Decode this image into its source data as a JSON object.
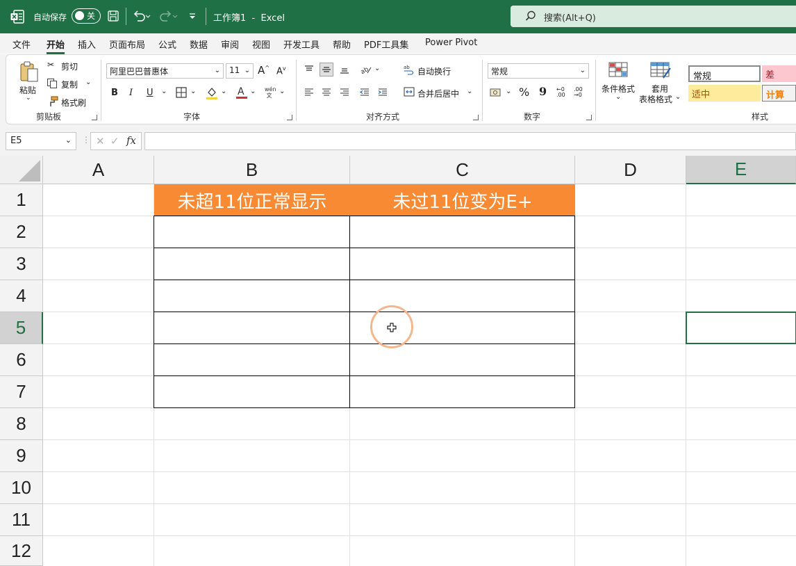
{
  "titlebar": {
    "autosave_label": "自动保存",
    "autosave_state": "关",
    "doc_title": "工作簿1  -  Excel",
    "search_placeholder": "搜索(Alt+Q)",
    "bg_color": "#1f7145"
  },
  "tabs": [
    {
      "label": "文件"
    },
    {
      "label": "开始",
      "active": true
    },
    {
      "label": "插入"
    },
    {
      "label": "页面布局"
    },
    {
      "label": "公式"
    },
    {
      "label": "数据"
    },
    {
      "label": "审阅"
    },
    {
      "label": "视图"
    },
    {
      "label": "开发工具"
    },
    {
      "label": "帮助"
    },
    {
      "label": "PDF工具集"
    },
    {
      "label": "Power Pivot"
    }
  ],
  "ribbon": {
    "clipboard": {
      "paste": "粘贴",
      "cut": "剪切",
      "copy": "复制",
      "format_painter": "格式刷",
      "group": "剪贴板"
    },
    "font": {
      "name": "阿里巴巴普惠体",
      "size": "11",
      "bold": "B",
      "italic": "I",
      "underline": "U",
      "group": "字体"
    },
    "alignment": {
      "wrap": "自动换行",
      "merge": "合并后居中",
      "group": "对齐方式"
    },
    "number": {
      "format": "常规",
      "percent": "%",
      "comma": "9",
      "group": "数字"
    },
    "styles": {
      "conditional": "条件格式",
      "table_fmt_1": "套用",
      "table_fmt_2": "表格格式",
      "normal": "常规",
      "bad": "差",
      "neutral": "适中",
      "calc": "计算",
      "group": "样式"
    }
  },
  "formula_bar": {
    "name_box": "E5",
    "fx": "fx",
    "value": ""
  },
  "columns": [
    "A",
    "B",
    "C",
    "D",
    "E"
  ],
  "rows": [
    "1",
    "2",
    "3",
    "4",
    "5",
    "6",
    "7",
    "8",
    "9",
    "10",
    "11",
    "12"
  ],
  "selected_cell": "E5",
  "cells": {
    "B1": "未超11位正常显示",
    "C1": "未过11位变为E+"
  },
  "colors": {
    "header_fill": "#f78a33",
    "accent": "#1f7145",
    "click_ring": "#f4b68c"
  }
}
